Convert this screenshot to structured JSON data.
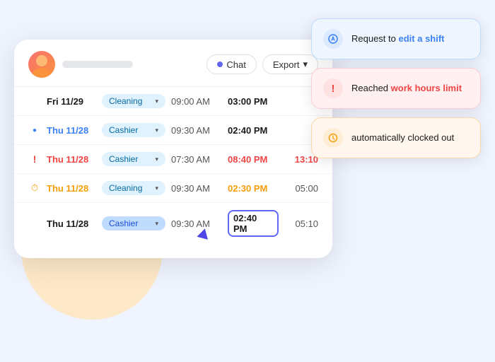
{
  "header": {
    "chat_label": "Chat",
    "export_label": "Export"
  },
  "rows": [
    {
      "icon": "",
      "icon_type": "none",
      "date": "Fri 11/29",
      "date_color": "normal",
      "role": "Cleaning",
      "role_type": "cleaning",
      "time_start": "09:00 AM",
      "time_end": "03:00 PM",
      "time_end_color": "normal",
      "duration": ""
    },
    {
      "icon": "●",
      "icon_type": "blue",
      "date": "Thu 11/28",
      "date_color": "blue",
      "role": "Cashier",
      "role_type": "cashier",
      "time_start": "09:30 AM",
      "time_end": "02:40 PM",
      "time_end_color": "normal",
      "duration": ""
    },
    {
      "icon": "!",
      "icon_type": "red",
      "date": "Thu 11/28",
      "date_color": "red",
      "role": "Cashier",
      "role_type": "cashier",
      "time_start": "07:30 AM",
      "time_end": "08:40 PM",
      "time_end_color": "red",
      "duration": "13:10"
    },
    {
      "icon": "⏱",
      "icon_type": "orange",
      "date": "Thu 11/28",
      "date_color": "orange",
      "role": "Cleaning",
      "role_type": "cleaning",
      "time_start": "09:30 AM",
      "time_end": "02:30 PM",
      "time_end_color": "orange",
      "duration": "05:00"
    },
    {
      "icon": "",
      "icon_type": "none",
      "date": "Thu 11/28",
      "date_color": "normal",
      "role": "Cashier",
      "role_type": "cashier-selected",
      "time_start": "09:30 AM",
      "time_end": "02:40 PM",
      "time_end_color": "highlighted",
      "duration": "05:10"
    }
  ],
  "tooltips": [
    {
      "type": "blue",
      "text_plain": "Request to ",
      "text_accent": "edit a shift",
      "accent_color": "blue"
    },
    {
      "type": "red",
      "text_plain": "Reached ",
      "text_accent": "work hours limit",
      "accent_color": "red"
    },
    {
      "type": "orange",
      "text_plain": "automatically clocked out",
      "text_accent": "",
      "accent_color": "none"
    }
  ]
}
